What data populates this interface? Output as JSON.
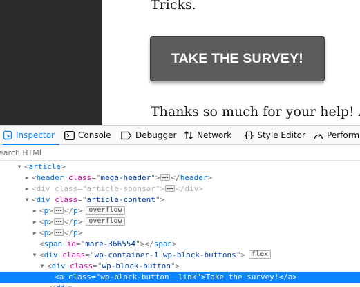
{
  "page": {
    "tricks_text": "Tricks.",
    "survey_button_label": "TAKE THE SURVEY!",
    "thanks_text": "Thanks so much for your help! And"
  },
  "devtools": {
    "tabs": [
      {
        "label": "Inspector",
        "icon": "inspector-icon",
        "active": true
      },
      {
        "label": "Console",
        "icon": "console-icon"
      },
      {
        "label": "Debugger",
        "icon": "debugger-icon"
      },
      {
        "label": "Network",
        "icon": "network-icon"
      },
      {
        "label": "Style Editor",
        "icon": "style-editor-icon"
      },
      {
        "label": "Perform",
        "icon": "performance-icon"
      }
    ],
    "search": {
      "placeholder": "Search HTML"
    },
    "tree": {
      "article": {
        "tag": "article"
      },
      "header": {
        "tag": "header",
        "attr": "class",
        "val": "mega-header",
        "close": "header"
      },
      "sponsor": {
        "tag": "div",
        "attr": "class",
        "val": "article-sponsor",
        "close": "div"
      },
      "content": {
        "tag": "div",
        "attr": "class",
        "val": "article-content"
      },
      "p": {
        "tag": "p",
        "close": "p"
      },
      "overflow_badge": "overflow",
      "span": {
        "tag": "span",
        "attr": "id",
        "val": "more-366554",
        "close": "span"
      },
      "container": {
        "tag": "div",
        "attr": "class",
        "val": "wp-container-1 wp-block-buttons",
        "badge": "flex"
      },
      "block_button": {
        "tag": "div",
        "attr": "class",
        "val": "wp-block-button"
      },
      "link": {
        "tag": "a",
        "attr": "class",
        "val": "wp-block-button__link",
        "text": "Take the survey!",
        "close": "a"
      },
      "div_close": "div"
    }
  },
  "colors": {
    "accent": "#0a84ff",
    "button_bg": "#5c5c5c",
    "rail": "#2b2b2b",
    "tag": "#0074e8",
    "attr_name": "#dd00a9",
    "attr_value": "#003eaa"
  }
}
